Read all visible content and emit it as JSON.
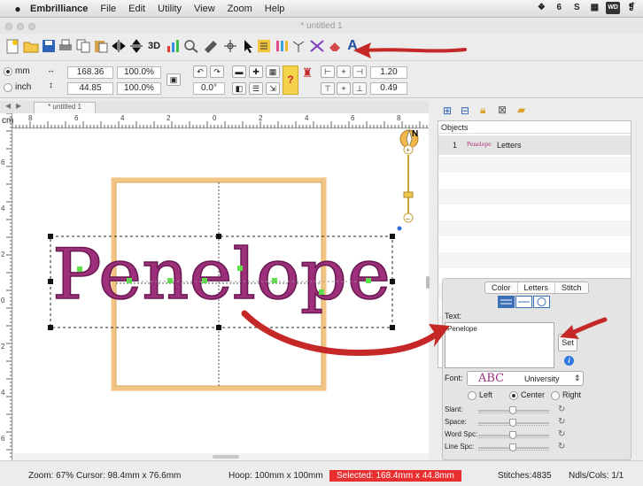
{
  "menubar": {
    "apple": "",
    "app_name": "Embrilliance",
    "items": [
      "File",
      "Edit",
      "Utility",
      "View",
      "Zoom",
      "Help"
    ],
    "tray": [
      "❖",
      "6",
      "S",
      "▦",
      "WD",
      "❡"
    ]
  },
  "window": {
    "title": "* untitled 1"
  },
  "toolbar": {
    "items": [
      "new-icon",
      "open-icon",
      "save-icon",
      "print-icon",
      "copy-icon",
      "paste-icon",
      "flip-horizontal-icon",
      "flip-vertical-icon",
      "3d-icon",
      "color-chart-icon",
      "zoom-icon",
      "ruler-icon",
      "center-icon",
      "select-arrow-icon",
      "list-icon",
      "color-sort-icon",
      "thread-icon",
      "layout-icon",
      "eraser-icon",
      "text-icon"
    ],
    "text_icon_label": "A",
    "label_3d": "3D"
  },
  "settings": {
    "unit_mm": "mm",
    "unit_inch": "inch",
    "width_mm": "168.36",
    "width_pct": "100.0%",
    "height_mm": "44.85",
    "height_pct": "100.0%",
    "rotation": "0.0°",
    "spacing_1": "1.20",
    "spacing_2": "0.49"
  },
  "canvas": {
    "tab_label": "* untitled 1",
    "ruler_unit": "cm",
    "top_ruler_labels": [
      "8",
      "6",
      "4",
      "2",
      "0",
      "2",
      "4",
      "6",
      "8"
    ],
    "left_ruler_labels": [
      "6",
      "4",
      "2",
      "0",
      "2",
      "4",
      "6"
    ],
    "compass_label": "N",
    "design_text": "Penelope"
  },
  "objects": {
    "header": "Objects",
    "rows": [
      {
        "index": "1",
        "thumb": "Penelope",
        "label": "Letters"
      }
    ]
  },
  "text_panel": {
    "tabs": [
      "Color",
      "Letters",
      "Stitch"
    ],
    "selected_tab": "Letters",
    "text_label": "Text:",
    "text_value": "Penelope",
    "set_button": "Set",
    "font_label": "Font:",
    "font_preview": "ABC",
    "font_name": "University",
    "align_left": "Left",
    "align_center": "Center",
    "align_right": "Right",
    "slant_label": "Slant:",
    "space_label": "Space:",
    "word_spc_label": "Word Spc:",
    "line_spc_label": "Line Spc:"
  },
  "status": {
    "zoom": "Zoom: 67%",
    "cursor": "Cursor: 98.4mm x 76.6mm",
    "hoop": "Hoop: 100mm x 100mm",
    "selected": "Selected: 168.4mm x 44.8mm",
    "stitches": "Stitches:4835",
    "ndls": "Ndls/Cols: 1/1"
  },
  "colors": {
    "thread": "#9e2f7b",
    "hoop_frame": "#f4c98a",
    "annotation_arrow": "#c62828",
    "selected_status_bg": "#e82e2e",
    "node_green": "#5ee04a"
  }
}
